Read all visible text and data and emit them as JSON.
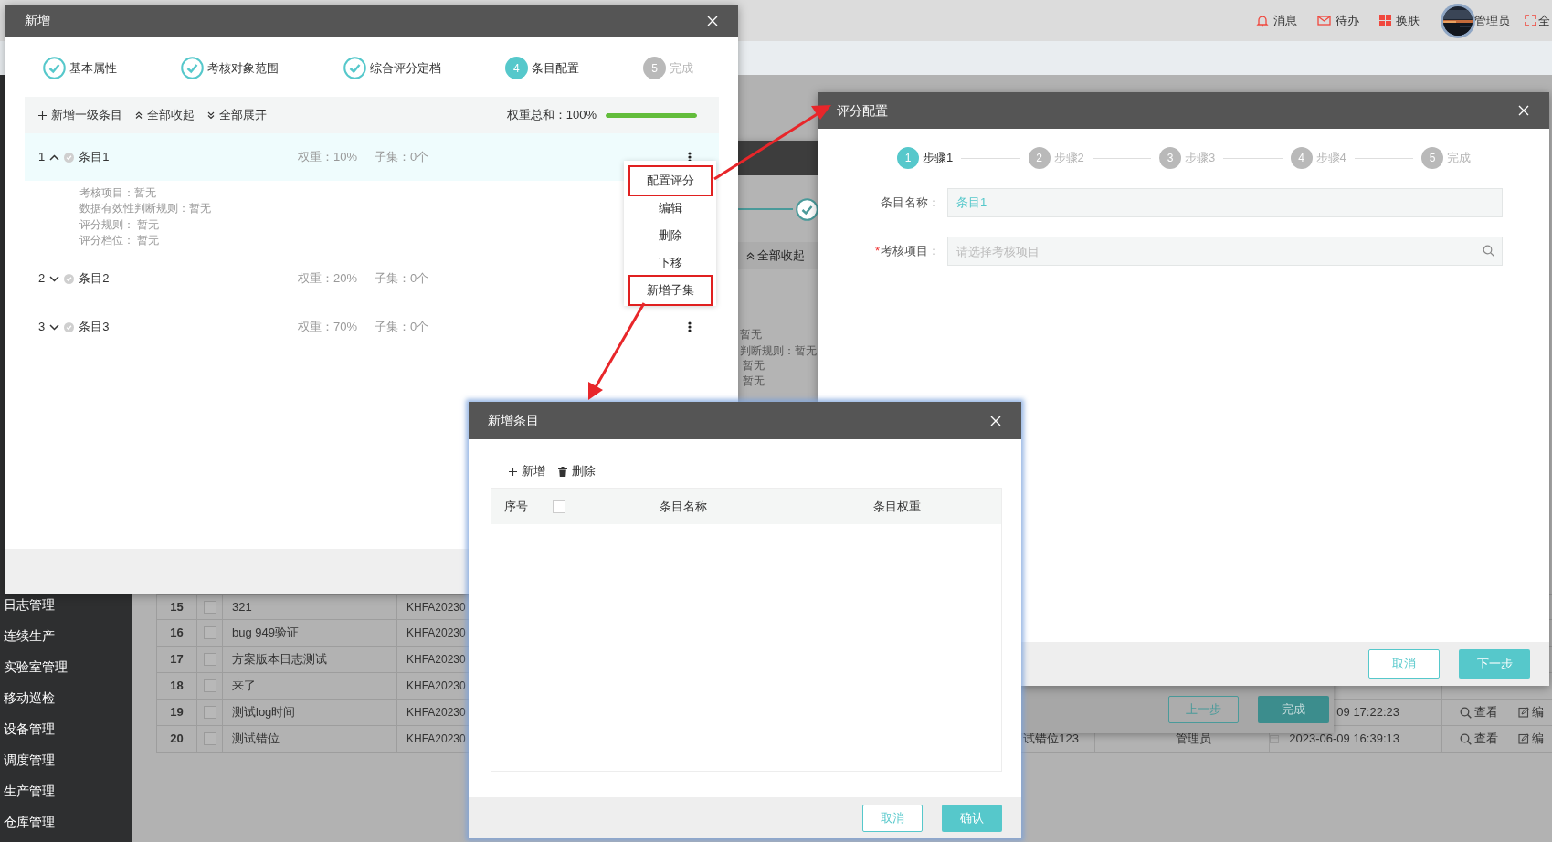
{
  "header": {
    "items": [
      {
        "kind": "bell",
        "label": "消息"
      },
      {
        "kind": "mail",
        "label": "待办"
      },
      {
        "kind": "skin",
        "label": "换肤"
      }
    ],
    "user": "管理员",
    "fullscreen_label": "全"
  },
  "sidebar": {
    "items": [
      "日志管理",
      "连续生产",
      "实验室管理",
      "移动巡检",
      "设备管理",
      "调度管理",
      "生产管理",
      "仓库管理"
    ]
  },
  "table": {
    "rows": [
      {
        "index": "15",
        "checked": false,
        "name": "321",
        "code": "KHFA20230"
      },
      {
        "index": "16",
        "checked": false,
        "name": "bug 949验证",
        "code": "KHFA20230"
      },
      {
        "index": "17",
        "checked": false,
        "name": "方案版本日志测试",
        "code": "KHFA20230"
      },
      {
        "index": "18",
        "checked": false,
        "name": "来了",
        "code": "KHFA20230"
      },
      {
        "index": "19",
        "checked": false,
        "name": "测试log时间",
        "code": "KHFA20230",
        "time": "09 17:22:23",
        "actions": [
          "查看",
          "编"
        ]
      },
      {
        "index": "20",
        "checked": false,
        "name": "测试错位",
        "code": "KHFA20230",
        "title": "试错位123",
        "user": "管理员",
        "time": "2023-06-09 16:39:13",
        "actions": [
          "查看",
          "编"
        ]
      }
    ]
  },
  "background_dialog": {
    "toolbar_label": "全部收起",
    "details": [
      "暂无",
      "判断规则：暂无",
      "暂无",
      "暂无"
    ],
    "buttons": [
      {
        "label": "上一步",
        "kind": "secondary"
      },
      {
        "label": "完成",
        "kind": "primary"
      }
    ]
  },
  "dialog_main": {
    "title": "新增",
    "steps": [
      {
        "label": "基本属性",
        "done": true,
        "selected": false
      },
      {
        "label": "考核对象范围",
        "done": true,
        "selected": false
      },
      {
        "label": "综合评分定档",
        "done": true,
        "selected": false
      },
      {
        "number": "4",
        "label": "条目配置",
        "done": false,
        "selected": true
      },
      {
        "number": "5",
        "label": "完成",
        "done": false,
        "selected": false
      }
    ],
    "toolbar": {
      "actions": [
        {
          "kind": "add",
          "label": "新增一级条目"
        },
        {
          "kind": "collapse",
          "label": "全部收起"
        },
        {
          "kind": "expand",
          "label": "全部展开"
        }
      ],
      "weight_label": "权重总和：100%",
      "level": 1
    },
    "items": [
      {
        "index": "1",
        "name": "条目1",
        "weight": "权重：10%",
        "children_count": "子集：0个",
        "expanded": true,
        "selected": true,
        "menu_icon": true,
        "details": [
          "考核项目：暂无",
          "数据有效性判断规则：暂无",
          "评分规则： 暂无",
          "评分档位： 暂无"
        ]
      },
      {
        "index": "2",
        "name": "条目2",
        "weight": "权重：20%",
        "children_count": "子集：0个",
        "expanded": false,
        "selected": false,
        "menu_icon": false
      },
      {
        "index": "3",
        "name": "条目3",
        "weight": "权重：70%",
        "children_count": "子集：0个",
        "expanded": false,
        "selected": false,
        "menu_icon": true
      }
    ],
    "menu": [
      {
        "label": "配置评分",
        "highlighted": true
      },
      {
        "label": "编辑",
        "highlighted": false
      },
      {
        "label": "删除",
        "highlighted": false
      },
      {
        "label": "下移",
        "highlighted": false
      },
      {
        "label": "新增子集",
        "highlighted": true
      }
    ]
  },
  "dialog_items": {
    "title": "新增条目",
    "toolbar": [
      {
        "kind": "add",
        "label": "新增"
      },
      {
        "kind": "delete",
        "label": "删除"
      }
    ],
    "columns": [
      "序号",
      "条目名称",
      "条目权重"
    ],
    "select_all_checked": false,
    "buttons": [
      {
        "label": "取消",
        "kind": "secondary"
      },
      {
        "label": "确认",
        "kind": "primary"
      }
    ]
  },
  "dialog_score": {
    "title": "评分配置",
    "steps": [
      {
        "number": "1",
        "label": "步骤1",
        "done": false,
        "selected": true
      },
      {
        "number": "2",
        "label": "步骤2",
        "done": false,
        "selected": false
      },
      {
        "number": "3",
        "label": "步骤3",
        "done": false,
        "selected": false
      },
      {
        "number": "4",
        "label": "步骤4",
        "done": false,
        "selected": false
      },
      {
        "number": "5",
        "label": "完成",
        "done": false,
        "selected": false
      }
    ],
    "fields": [
      {
        "kind": "text",
        "label": "条目名称：",
        "value": "条目1"
      },
      {
        "kind": "search",
        "label": "考核项目：",
        "placeholder": "请选择考核项目",
        "required_mark": "*"
      }
    ],
    "buttons": [
      {
        "label": "取消",
        "kind": "secondary"
      },
      {
        "label": "下一步",
        "kind": "primary"
      }
    ]
  }
}
